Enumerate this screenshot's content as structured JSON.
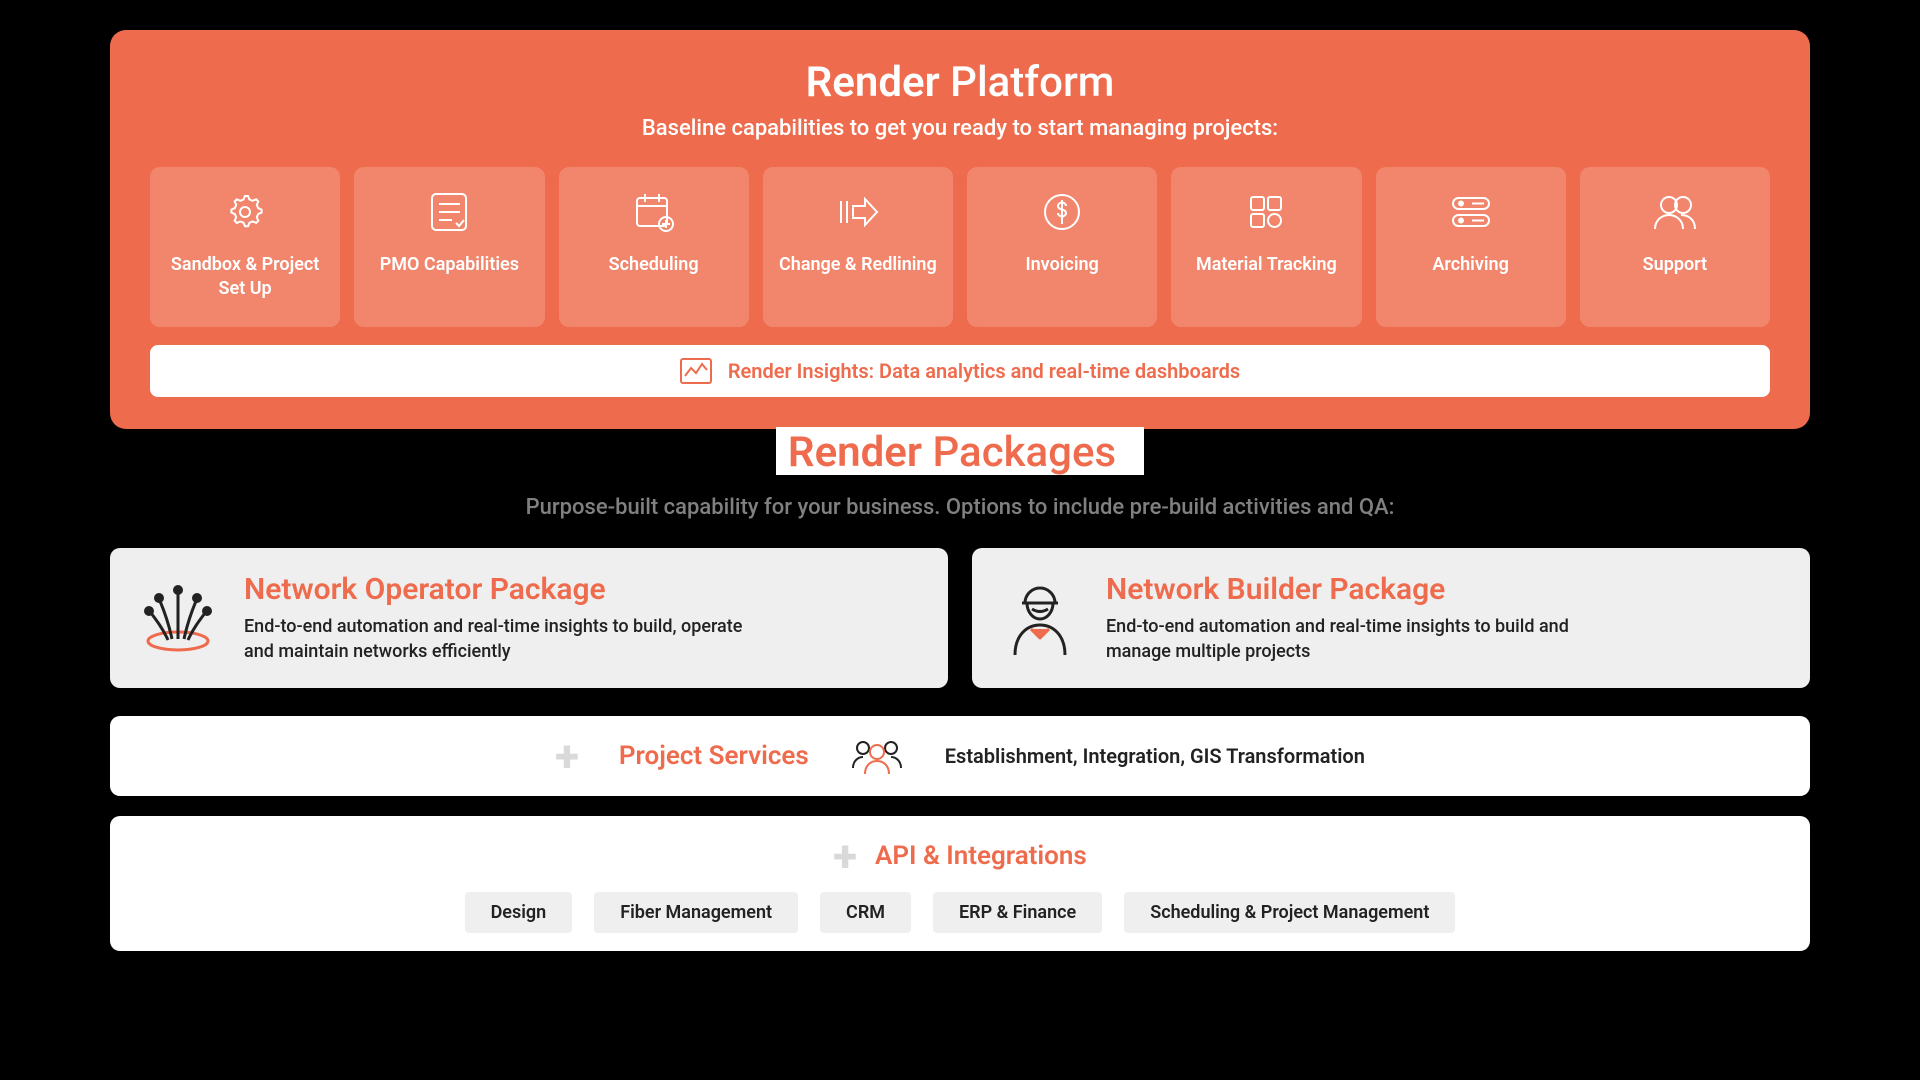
{
  "platform": {
    "brand": "Render",
    "word": "Platform",
    "subtitle": "Baseline capabilities to get you ready to start managing projects:",
    "capabilities": [
      {
        "label": "Sandbox & Project Set Up"
      },
      {
        "label": "PMO Capabilities"
      },
      {
        "label": "Scheduling"
      },
      {
        "label": "Change & Redlining"
      },
      {
        "label": "Invoicing"
      },
      {
        "label": "Material Tracking"
      },
      {
        "label": "Archiving"
      },
      {
        "label": "Support"
      }
    ],
    "insights_label": "Render Insights: Data analytics and real-time dashboards"
  },
  "packages": {
    "brand": "Render",
    "word": "Packages",
    "subtitle": "Purpose-built capability for your business. Options to include pre-build activities and QA:",
    "items": [
      {
        "title": "Network Operator Package",
        "desc": "End-to-end automation and real-time insights to build, operate and maintain networks efficiently"
      },
      {
        "title": "Network Builder Package",
        "desc": "End-to-end automation and real-time insights to build and manage multiple projects"
      }
    ]
  },
  "services": {
    "title": "Project Services",
    "desc": "Establishment, Integration, GIS Transformation"
  },
  "api": {
    "title": "API & Integrations",
    "tags": [
      "Design",
      "Fiber Management",
      "CRM",
      "ERP & Finance",
      "Scheduling & Project Management"
    ]
  },
  "colors": {
    "accent": "#EE6C4D"
  }
}
